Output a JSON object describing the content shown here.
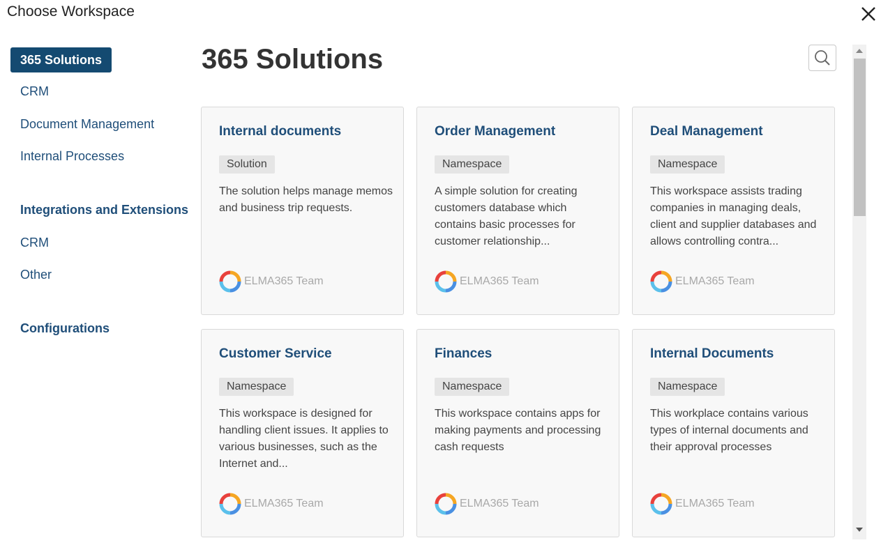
{
  "dialog": {
    "title": "Choose Workspace",
    "close_icon": "close-icon"
  },
  "sidebar": {
    "active": "365 Solutions",
    "items": [
      "CRM",
      "Document Management",
      "Internal Processes"
    ],
    "section_integrations": "Integrations and Extensions",
    "integration_items": [
      "CRM",
      "Other"
    ],
    "section_configurations": "Configurations"
  },
  "main": {
    "title": "365 Solutions",
    "search_icon": "search-icon"
  },
  "cards": [
    {
      "title": "Internal documents",
      "badge": "Solution",
      "description": "The solution helps manage memos and business trip requests.",
      "author": "ELMA365 Team"
    },
    {
      "title": "Order Management",
      "badge": "Namespace",
      "description": "A simple solution for creating customers database which contains basic processes for customer relationship...",
      "author": "ELMA365 Team"
    },
    {
      "title": "Deal Management",
      "badge": "Namespace",
      "description": "This workspace assists trading companies in managing deals, client and supplier databases and allows controlling contra...",
      "author": "ELMA365 Team"
    },
    {
      "title": "Customer Service",
      "badge": "Namespace",
      "description": "This workspace is designed for handling client issues. It applies to various businesses, such as the Internet and...",
      "author": "ELMA365 Team"
    },
    {
      "title": "Finances",
      "badge": "Namespace",
      "description": "This workspace contains apps for making payments and processing cash requests",
      "author": "ELMA365 Team"
    },
    {
      "title": "Internal Documents",
      "badge": "Namespace",
      "description": "This workplace contains various types of internal documents and their approval processes",
      "author": "ELMA365 Team"
    }
  ],
  "colors": {
    "accent": "#144a71",
    "link": "#1f4e79",
    "logo_red": "#e8413c",
    "logo_orange": "#f5a623",
    "logo_blue": "#4a90e2",
    "logo_cyan": "#5bc0eb"
  }
}
